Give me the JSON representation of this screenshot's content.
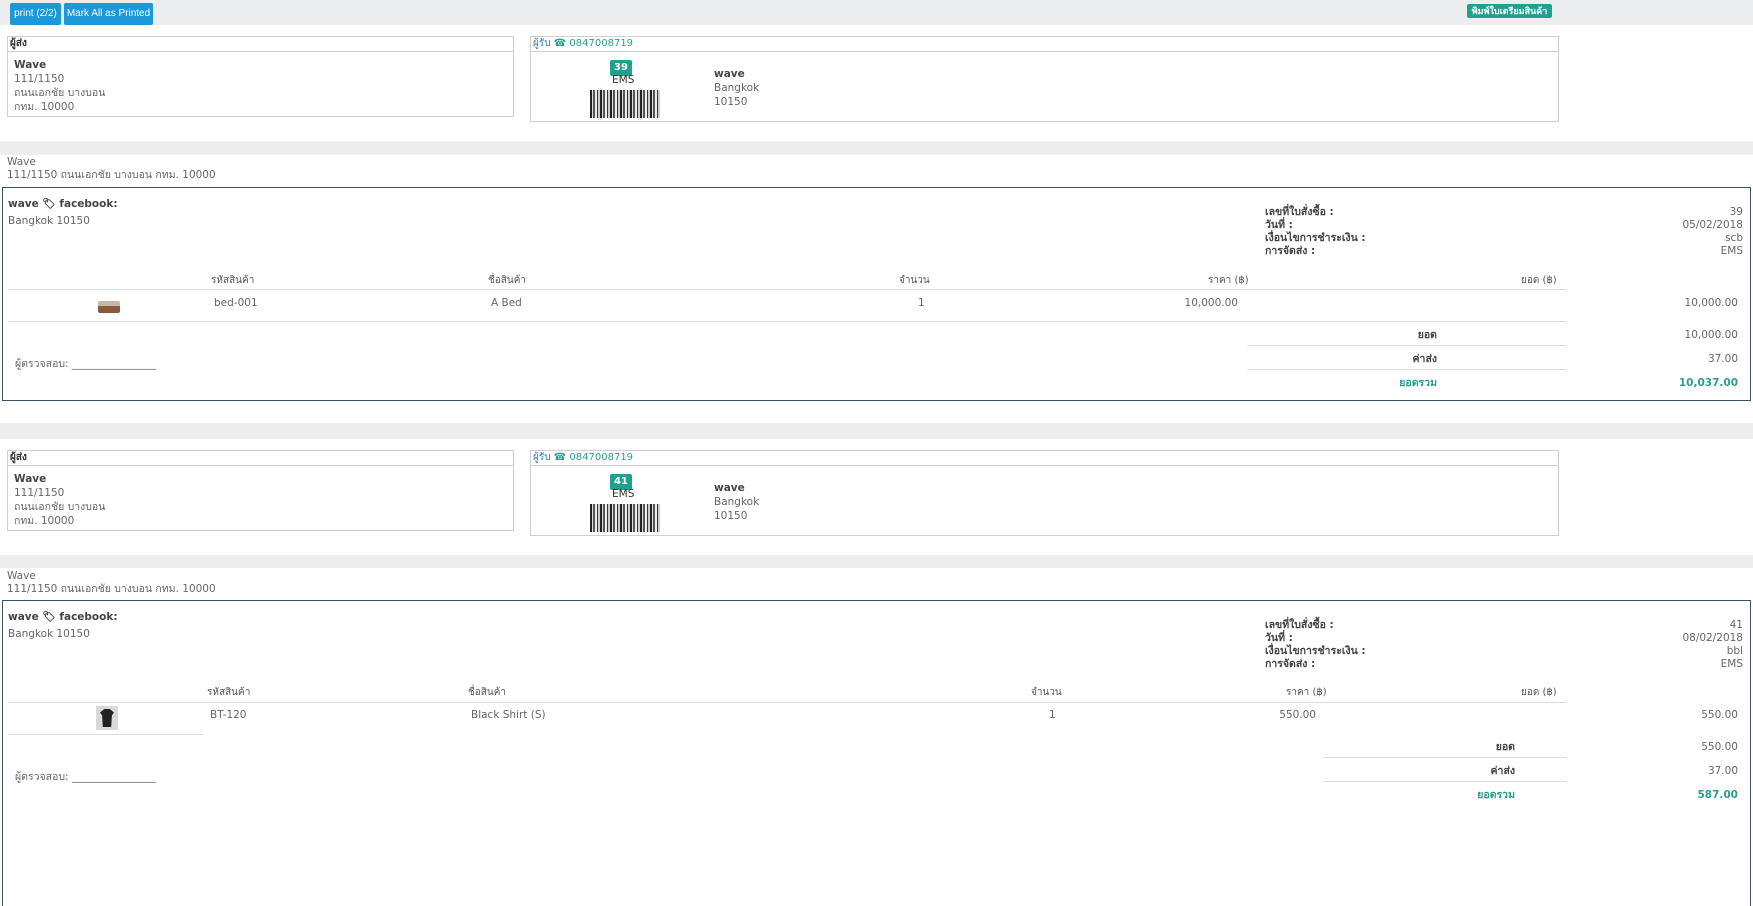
{
  "toolbar": {
    "print_label": "print (2/2)",
    "mark_label": "Mark All as Printed",
    "prep_label": "พิมพ์ใบเตรียมสินค้า"
  },
  "orders": [
    {
      "sender_header": "ผู้ส่ง",
      "sender": {
        "name": "Wave",
        "line1": "111/1150",
        "line2": "ถนนเอกชัย บางบอน",
        "line3": "กทม. 10000"
      },
      "receiver_header": "ผู้รับ",
      "phone": "0847008719",
      "order_badge": "39",
      "carrier": "EMS",
      "receiver": {
        "name": "wave",
        "city": "Bangkok",
        "zip": "10150"
      },
      "shop": {
        "name": "Wave",
        "address": "111/1150 ถนนเอกชัย บางบอน กทม. 10000"
      },
      "customer": {
        "name": "wave",
        "social": "facebook:",
        "address": "Bangkok 10150"
      },
      "meta": {
        "order_no_label": "เลขที่ใบสั่งซื้อ :",
        "order_no": "39",
        "date_label": "วันที่ :",
        "date": "05/02/2018",
        "payment_label": "เงื่อนไขการชำระเงิน :",
        "payment": "scb",
        "shipping_label": "การจัดส่ง :",
        "shipping": "EMS"
      },
      "table": {
        "headers": [
          "รหัสสินค้า",
          "ชื่อสินค้า",
          "จำนวน",
          "ราคา (฿)",
          "ยอด (฿)"
        ],
        "rows": [
          {
            "sku": "bed-001",
            "name": "A Bed",
            "qty": "1",
            "price": "10,000.00",
            "amount": "10,000.00",
            "thumb": "bed-image"
          }
        ]
      },
      "summary": {
        "subtotal_label": "ยอด",
        "subtotal": "10,000.00",
        "shipping_label": "ค่าส่ง",
        "shipping": "37.00",
        "total_label": "ยอดรวม",
        "total": "10,037.00"
      },
      "checker": "ผู้ตรวจสอบ: ________________"
    },
    {
      "sender_header": "ผู้ส่ง",
      "sender": {
        "name": "Wave",
        "line1": "111/1150",
        "line2": "ถนนเอกชัย บางบอน",
        "line3": "กทม. 10000"
      },
      "receiver_header": "ผู้รับ",
      "phone": "0847008719",
      "order_badge": "41",
      "carrier": "EMS",
      "receiver": {
        "name": "wave",
        "city": "Bangkok",
        "zip": "10150"
      },
      "shop": {
        "name": "Wave",
        "address": "111/1150 ถนนเอกชัย บางบอน กทม. 10000"
      },
      "customer": {
        "name": "wave",
        "social": "facebook:",
        "address": "Bangkok 10150"
      },
      "meta": {
        "order_no_label": "เลขที่ใบสั่งซื้อ :",
        "order_no": "41",
        "date_label": "วันที่ :",
        "date": "08/02/2018",
        "payment_label": "เงื่อนไขการชำระเงิน :",
        "payment": "bbl",
        "shipping_label": "การจัดส่ง :",
        "shipping": "EMS"
      },
      "table": {
        "headers": [
          "รหัสสินค้า",
          "ชื่อสินค้า",
          "จำนวน",
          "ราคา (฿)",
          "ยอด (฿)"
        ],
        "rows": [
          {
            "sku": "BT-120",
            "name": "Black Shirt (S)",
            "qty": "1",
            "price": "550.00",
            "amount": "550.00",
            "thumb": "shirt-image"
          }
        ]
      },
      "summary": {
        "subtotal_label": "ยอด",
        "subtotal": "550.00",
        "shipping_label": "ค่าส่ง",
        "shipping": "37.00",
        "total_label": "ยอดรวม",
        "total": "587.00"
      },
      "checker": "ผู้ตรวจสอบ: ________________"
    }
  ],
  "icons": {
    "phone": "phone-icon",
    "tag": "tag-icon"
  },
  "colors": {
    "primary": "#1b98d8",
    "teal": "#21a090",
    "border": "#3a5068",
    "background": "#ebedef"
  }
}
